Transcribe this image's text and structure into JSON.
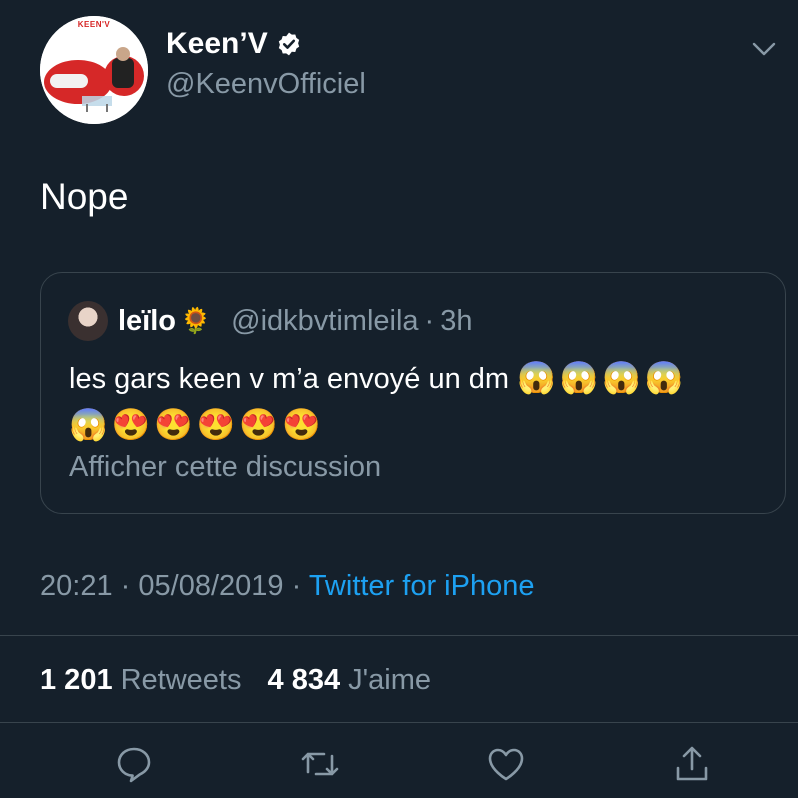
{
  "author": {
    "display_name": "Keen’V",
    "handle": "@KeenvOfficiel",
    "avatar_logo_text": "KEEN'V",
    "verified_icon": "verified-badge-icon"
  },
  "tweet": {
    "text": "Nope",
    "time": "20:21",
    "date": "05/08/2019",
    "separator": "·",
    "source": "Twitter for iPhone"
  },
  "quote": {
    "name": "leïlo",
    "name_emoji": "🌻",
    "handle": "@idkbvtimleila",
    "separator": "·",
    "time": "3h",
    "text": "les gars keen v m’a envoyé un dm",
    "emojis_line1": "😱😱😱😱",
    "emojis_line2": "😱😍😍😍😍😍",
    "show_thread": "Afficher cette discussion"
  },
  "stats": {
    "retweets_count": "1 201",
    "retweets_label": "Retweets",
    "likes_count": "4 834",
    "likes_label": "J'aime"
  },
  "actions": [
    "reply-icon",
    "retweet-icon",
    "like-icon",
    "share-icon"
  ],
  "colors": {
    "background": "#15202b",
    "secondary_text": "#8899a6",
    "link": "#1da1f2",
    "border": "#38444d"
  }
}
